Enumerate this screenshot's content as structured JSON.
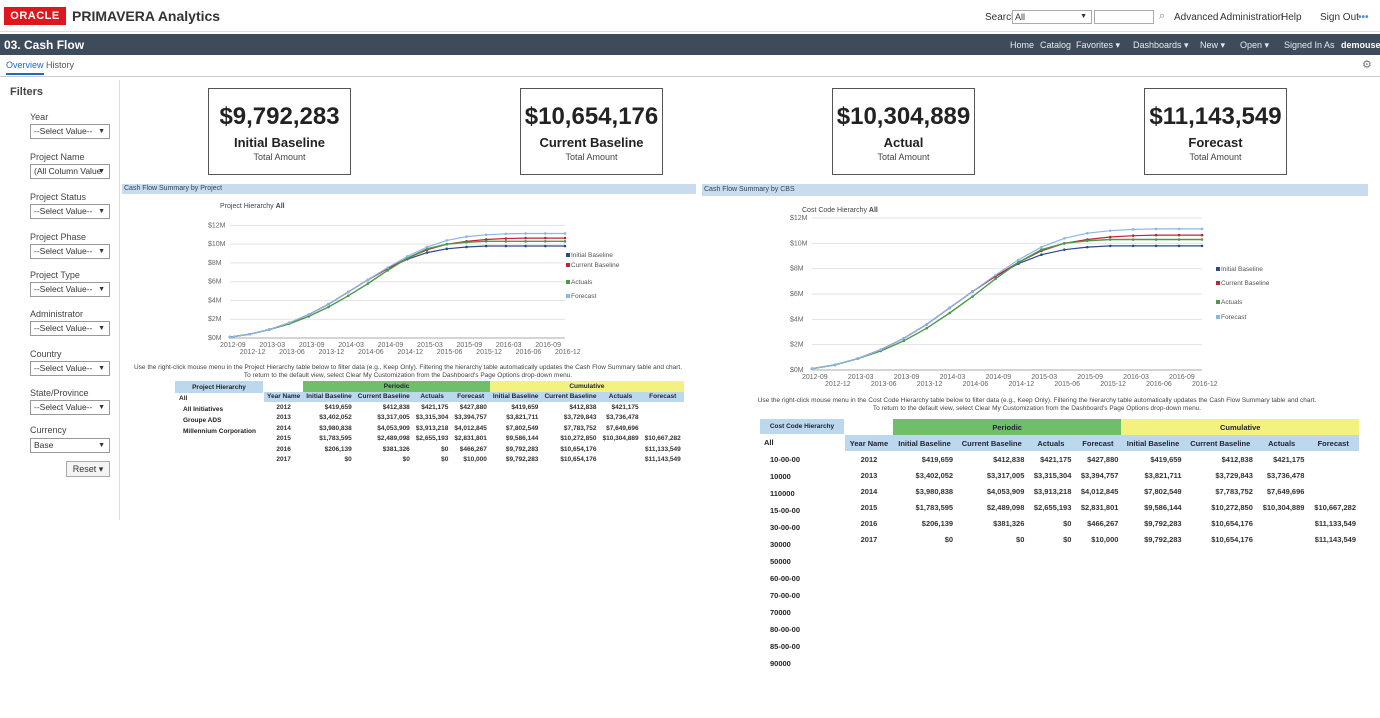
{
  "header": {
    "logo": "ORACLE",
    "product": "PRIMAVERA Analytics",
    "search_label": "Search",
    "search_scope": "All",
    "advanced": "Advanced",
    "administration": "Administration",
    "help": "Help",
    "sign_out": "Sign Out"
  },
  "titlebar": {
    "title": "03. Cash Flow",
    "nav": [
      "Home",
      "Catalog",
      "Favorites ▾",
      "Dashboards ▾",
      "New ▾",
      "Open ▾",
      "Signed In As"
    ],
    "user": "demouser"
  },
  "tabs": [
    "Overview",
    "History"
  ],
  "filters": {
    "title": "Filters",
    "items": [
      {
        "label": "Year",
        "value": "--Select Value--"
      },
      {
        "label": "Project Name",
        "value": "(All Column Value"
      },
      {
        "label": "Project Status",
        "value": "--Select Value--"
      },
      {
        "label": "Project Phase",
        "value": "--Select Value--"
      },
      {
        "label": "Project Type",
        "value": "--Select Value--"
      },
      {
        "label": "Administrator",
        "value": "--Select Value--"
      },
      {
        "label": "Country",
        "value": "--Select Value--"
      },
      {
        "label": "State/Province",
        "value": "--Select Value--"
      },
      {
        "label": "Currency",
        "value": "Base"
      }
    ],
    "reset": "Reset ▾"
  },
  "kpis": [
    {
      "value": "$9,792,283",
      "label": "Initial Baseline",
      "sub": "Total Amount"
    },
    {
      "value": "$10,654,176",
      "label": "Current Baseline",
      "sub": "Total Amount"
    },
    {
      "value": "$10,304,889",
      "label": "Actual",
      "sub": "Total Amount"
    },
    {
      "value": "$11,143,549",
      "label": "Forecast",
      "sub": "Total Amount"
    }
  ],
  "sections": {
    "left": "Cash Flow Summary by Project",
    "right": "Cash Flow Summary by CBS"
  },
  "colors": {
    "initial_baseline": "#2b4a8a",
    "current_baseline": "#c0223a",
    "actuals": "#4a9a4a",
    "forecast": "#8ab6e8"
  },
  "chart_data": [
    {
      "type": "line",
      "hierarchy_label": "Project Hierarchy",
      "hierarchy_value": "All",
      "x": [
        "2012-09",
        "2012-12",
        "2013-03",
        "2013-06",
        "2013-09",
        "2013-12",
        "2014-03",
        "2014-06",
        "2014-09",
        "2014-12",
        "2015-03",
        "2015-06",
        "2015-09",
        "2015-12",
        "2016-03",
        "2016-06",
        "2016-09",
        "2016-12"
      ],
      "ylim": [
        0,
        13000000
      ],
      "yticks": [
        "$0M",
        "$2M",
        "$4M",
        "$6M",
        "$8M",
        "$10M",
        "$12M"
      ],
      "series": [
        {
          "name": "Initial Baseline",
          "values": [
            0.1,
            0.4,
            0.9,
            1.6,
            2.5,
            3.6,
            4.9,
            6.2,
            7.4,
            8.4,
            9.1,
            9.5,
            9.7,
            9.8,
            9.8,
            9.8,
            9.8,
            9.8
          ]
        },
        {
          "name": "Current Baseline",
          "values": [
            0.1,
            0.4,
            0.9,
            1.6,
            2.5,
            3.6,
            4.9,
            6.2,
            7.4,
            8.5,
            9.4,
            10.0,
            10.3,
            10.5,
            10.6,
            10.65,
            10.65,
            10.65
          ]
        },
        {
          "name": "Actuals",
          "values": [
            0.1,
            0.4,
            0.9,
            1.5,
            2.3,
            3.3,
            4.5,
            5.8,
            7.2,
            8.5,
            9.5,
            10.0,
            10.2,
            10.3,
            10.3,
            10.3,
            10.3,
            10.3
          ]
        },
        {
          "name": "Forecast",
          "values": [
            0.1,
            0.4,
            0.9,
            1.6,
            2.5,
            3.6,
            4.9,
            6.2,
            7.5,
            8.7,
            9.7,
            10.4,
            10.8,
            11.0,
            11.1,
            11.14,
            11.14,
            11.14
          ]
        }
      ]
    },
    {
      "type": "line",
      "hierarchy_label": "Cost Code Hierarchy",
      "hierarchy_value": "All",
      "x": [
        "2012-09",
        "2012-12",
        "2013-03",
        "2013-06",
        "2013-09",
        "2013-12",
        "2014-03",
        "2014-06",
        "2014-09",
        "2014-12",
        "2015-03",
        "2015-06",
        "2015-09",
        "2015-12",
        "2016-03",
        "2016-06",
        "2016-09",
        "2016-12"
      ],
      "ylim": [
        0,
        12000000
      ],
      "yticks": [
        "$0M",
        "$2M",
        "$4M",
        "$6M",
        "$8M",
        "$10M",
        "$12M"
      ],
      "series": [
        {
          "name": "Initial Baseline",
          "values": [
            0.1,
            0.4,
            0.9,
            1.6,
            2.5,
            3.6,
            4.9,
            6.2,
            7.4,
            8.4,
            9.1,
            9.5,
            9.7,
            9.8,
            9.8,
            9.8,
            9.8,
            9.8
          ]
        },
        {
          "name": "Current Baseline",
          "values": [
            0.1,
            0.4,
            0.9,
            1.6,
            2.5,
            3.6,
            4.9,
            6.2,
            7.4,
            8.5,
            9.4,
            10.0,
            10.3,
            10.5,
            10.6,
            10.65,
            10.65,
            10.65
          ]
        },
        {
          "name": "Actuals",
          "values": [
            0.1,
            0.4,
            0.9,
            1.5,
            2.3,
            3.3,
            4.5,
            5.8,
            7.2,
            8.5,
            9.5,
            10.0,
            10.2,
            10.3,
            10.3,
            10.3,
            10.3,
            10.3
          ]
        },
        {
          "name": "Forecast",
          "values": [
            0.1,
            0.4,
            0.9,
            1.6,
            2.5,
            3.6,
            4.9,
            6.2,
            7.5,
            8.7,
            9.7,
            10.4,
            10.8,
            11.0,
            11.1,
            11.14,
            11.14,
            11.14
          ]
        }
      ]
    }
  ],
  "instructions": {
    "left_1": "Use the right-click mouse menu in the Project Hierarchy table below to filter data (e.g., Keep Only). Filtering the hierarchy table automatically updates the Cash Flow Summary table and chart.",
    "left_2": "To return to the default view, select Clear My Customization from the Dashboard's Page Options drop-down menu.",
    "right_1": "Use the right-click mouse menu in the Cost Code Hierarchy table below to filter data (e.g., Keep Only). Filtering the hierarchy table automatically updates the Cash Flow Summary table and chart.",
    "right_2": "To return to the default view, select Clear My Customization from the Dashboard's Page Options drop-down menu."
  },
  "project_hierarchy": {
    "header": "Project Hierarchy",
    "rows": [
      "All",
      "All Initiatives",
      "Groupe ADS",
      "Millennium Corporation"
    ]
  },
  "cbs_hierarchy": {
    "header": "Cost Code Hierarchy",
    "rows": [
      "All",
      "10-00-00",
      "10000",
      "110000",
      "15-00-00",
      "30-00-00",
      "30000",
      "50000",
      "60-00-00",
      "70-00-00",
      "70000",
      "80-00-00",
      "85-00-00",
      "90000"
    ]
  },
  "summary_table": {
    "group_periodic": "Periodic",
    "group_cumulative": "Cumulative",
    "columns": [
      "Year Name",
      "Initial Baseline",
      "Current Baseline",
      "Actuals",
      "Forecast",
      "Initial Baseline",
      "Current Baseline",
      "Actuals",
      "Forecast"
    ],
    "rows": [
      [
        "2012",
        "$419,659",
        "$412,838",
        "$421,175",
        "$427,880",
        "$419,659",
        "$412,838",
        "$421,175",
        ""
      ],
      [
        "2013",
        "$3,402,052",
        "$3,317,005",
        "$3,315,304",
        "$3,394,757",
        "$3,821,711",
        "$3,729,843",
        "$3,736,478",
        ""
      ],
      [
        "2014",
        "$3,980,838",
        "$4,053,909",
        "$3,913,218",
        "$4,012,845",
        "$7,802,549",
        "$7,783,752",
        "$7,649,696",
        ""
      ],
      [
        "2015",
        "$1,783,595",
        "$2,489,098",
        "$2,655,193",
        "$2,831,801",
        "$9,586,144",
        "$10,272,850",
        "$10,304,889",
        "$10,667,282"
      ],
      [
        "2016",
        "$206,139",
        "$381,326",
        "$0",
        "$466,267",
        "$9,792,283",
        "$10,654,176",
        "",
        "$11,133,549"
      ],
      [
        "2017",
        "$0",
        "$0",
        "$0",
        "$10,000",
        "$9,792,283",
        "$10,654,176",
        "",
        "$11,143,549"
      ]
    ]
  }
}
